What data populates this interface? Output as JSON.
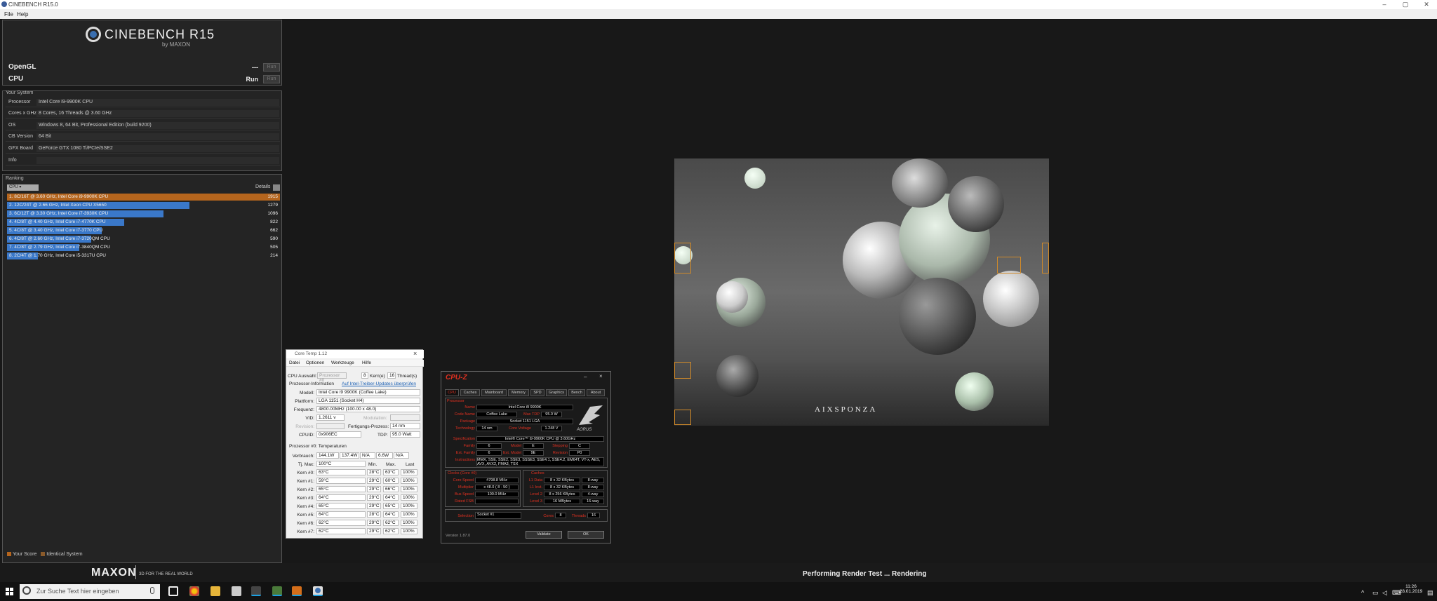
{
  "window": {
    "title": "CINEBENCH R15.0",
    "minimize": "–",
    "maximize": "▢",
    "close": "✕"
  },
  "menu": [
    "File",
    "Help"
  ],
  "logo": {
    "name": "CINEBENCH R15",
    "sub": "by MAXON"
  },
  "tests": [
    {
      "name": "OpenGL",
      "value": "---",
      "button": "Run"
    },
    {
      "name": "CPU",
      "value": "Run",
      "button": "Run"
    }
  ],
  "system": {
    "title": "Your System",
    "rows": [
      {
        "key": "Processor",
        "value": "Intel Core i9-9900K CPU"
      },
      {
        "key": "Cores x GHz",
        "value": "8 Cores, 16 Threads @ 3.60 GHz"
      },
      {
        "key": "OS",
        "value": "Windows 8, 64 Bit, Professional Edition (build 9200)"
      },
      {
        "key": "CB Version",
        "value": "64 Bit"
      },
      {
        "key": "GFX Board",
        "value": "GeForce GTX 1080 Ti/PCIe/SSE2"
      },
      {
        "key": "Info",
        "value": ""
      }
    ]
  },
  "ranking": {
    "title": "Ranking",
    "select": "CPU",
    "details": "Details",
    "entries": [
      {
        "label": "1. 8C/16T @ 3.60 GHz, Intel Core i9-9900K CPU",
        "score": "1915",
        "fraction": 1.0,
        "color": "#b5651d"
      },
      {
        "label": "2. 12C/24T @ 2.66 GHz, Intel Xeon CPU X5650",
        "score": "1279",
        "fraction": 0.668,
        "color": "#3a78c9"
      },
      {
        "label": "3. 6C/12T @ 3.30 GHz, Intel Core i7-3930K CPU",
        "score": "1096",
        "fraction": 0.572,
        "color": "#3a78c9"
      },
      {
        "label": "4. 4C/8T @ 4.40 GHz, Intel Core i7-4770K CPU",
        "score": "822",
        "fraction": 0.429,
        "color": "#3a78c9"
      },
      {
        "label": "5. 4C/8T @ 3.40 GHz, Intel Core i7-3770 CPU",
        "score": "662",
        "fraction": 0.346,
        "color": "#3a78c9"
      },
      {
        "label": "6. 4C/8T @ 2.60 GHz, Intel Core i7-3720QM CPU",
        "score": "590",
        "fraction": 0.308,
        "color": "#3a78c9"
      },
      {
        "label": "7. 4C/8T @ 2.79 GHz, Intel Core i7-3840QM CPU",
        "score": "505",
        "fraction": 0.264,
        "color": "#3a78c9"
      },
      {
        "label": "8. 2C/4T @ 1.70 GHz, Intel Core i5-3317U CPU",
        "score": "214",
        "fraction": 0.112,
        "color": "#3a78c9"
      }
    ],
    "legend": [
      {
        "label": "Your Score",
        "color": "#b5651d"
      },
      {
        "label": "Identical System",
        "color": "#8a5a2a"
      }
    ]
  },
  "footer": {
    "brand": "MAXON",
    "tagline": "3D FOR THE REAL WORLD",
    "status": "Performing Render Test ... Rendering"
  },
  "render": {
    "brand": "AIXSPONZA"
  },
  "coretemp": {
    "title": "Core Temp 1.12",
    "menu": [
      "Datei",
      "Optionen",
      "Werkzeuge",
      "Hilfe"
    ],
    "cpu_select_label": "CPU Auswahl:",
    "cpu_select": "Prozessor #0",
    "cores": "8",
    "cores_label": "Kern(e)",
    "threads": "16",
    "threads_label": "Thread(s)",
    "info_label": "Prozessor-Information",
    "update_link": "Auf Intel-Treiber-Updates überprüfen",
    "model_label": "Modell:",
    "model": "Intel Core i9 9900K (Coffee Lake)",
    "platform_label": "Plattform:",
    "platform": "LGA 1151 (Socket H4)",
    "freq_label": "Frequenz:",
    "freq": "4800.00MHz (100.00 x 48.0)",
    "vid_label": "VID:",
    "vid": "1.2611 v",
    "modulation_label": "Modulation:",
    "revision_label": "Revision:",
    "lithography_label": "Fertigungs-Prozess:",
    "lithography": "14 nm",
    "cpuid_label": "CPUID:",
    "cpuid": "0x906EC",
    "tdp_label": "TDP:",
    "tdp": "95.0 Watt",
    "temps_label": "Prozessor #0: Temperaturen",
    "power_label": "Verbrauch:",
    "power": [
      "144.1W",
      "137.4W",
      "N/A",
      "6.6W",
      "N/A"
    ],
    "tj_label": "Tj. Max:",
    "tj": "100°C",
    "headers": [
      "Min.",
      "Max.",
      "Last"
    ],
    "cores_list": [
      {
        "name": "Kern #0:",
        "cur": "63°C",
        "min": "28°C",
        "max": "63°C",
        "load": "100%"
      },
      {
        "name": "Kern #1:",
        "cur": "59°C",
        "min": "29°C",
        "max": "60°C",
        "load": "100%"
      },
      {
        "name": "Kern #2:",
        "cur": "65°C",
        "min": "29°C",
        "max": "66°C",
        "load": "100%"
      },
      {
        "name": "Kern #3:",
        "cur": "64°C",
        "min": "29°C",
        "max": "64°C",
        "load": "100%"
      },
      {
        "name": "Kern #4:",
        "cur": "65°C",
        "min": "29°C",
        "max": "65°C",
        "load": "100%"
      },
      {
        "name": "Kern #5:",
        "cur": "64°C",
        "min": "28°C",
        "max": "64°C",
        "load": "100%"
      },
      {
        "name": "Kern #6:",
        "cur": "62°C",
        "min": "29°C",
        "max": "62°C",
        "load": "100%"
      },
      {
        "name": "Kern #7:",
        "cur": "62°C",
        "min": "29°C",
        "max": "62°C",
        "load": "100%"
      }
    ]
  },
  "cpuz": {
    "title": "CPU-Z",
    "tabs": [
      "CPU",
      "Caches",
      "Mainboard",
      "Memory",
      "SPD",
      "Graphics",
      "Bench",
      "About"
    ],
    "processor_title": "Processor",
    "name_label": "Name",
    "name": "Intel Core i9 9900K",
    "code_label": "Code Name",
    "code": "Coffee Lake",
    "maxtdp_label": "Max TDP",
    "maxtdp": "95.0 W",
    "package_label": "Package",
    "package": "Socket 1151 LGA",
    "tech_label": "Technology",
    "tech": "14 nm",
    "cv_label": "Core Voltage",
    "cv": "1.248 V",
    "spec_label": "Specification",
    "spec": "Intel® Core™ i9-9900K CPU @ 3.60GHz",
    "family_label": "Family",
    "family": "6",
    "model_label": "Model",
    "model": "E",
    "stepping_label": "Stepping",
    "stepping": "C",
    "extfam_label": "Ext. Family",
    "extfam": "6",
    "extmodel_label": "Ext. Model",
    "extmodel": "9E",
    "revision_label": "Revision",
    "revision": "P0",
    "instr_label": "Instructions",
    "instr": "MMX, SSE, SSE2, SSE3, SSSE3, SSE4.1, SSE4.2, EM64T, VT-x, AES, AVX, AVX2, FMA3, TSX",
    "clocks_title": "Clocks (Core #0)",
    "caches_title": "Caches",
    "corespeed_label": "Core Speed",
    "corespeed": "4798.8 MHz",
    "mult_label": "Multiplier",
    "mult": "x 48.0 ( 8 - 50 )",
    "bus_label": "Bus Speed",
    "bus": "100.0 MHz",
    "fsb_label": "Rated FSB",
    "fsb": "",
    "l1d_label": "L1 Data",
    "l1d": "8 x 32 KBytes",
    "l1d_way": "8-way",
    "l1i_label": "L1 Inst.",
    "l1i": "8 x 32 KBytes",
    "l1i_way": "8-way",
    "l2_label": "Level 2",
    "l2": "8 x 256 KBytes",
    "l2_way": "4-way",
    "l3_label": "Level 3",
    "l3": "16 MBytes",
    "l3_way": "16-way",
    "selection_label": "Selection",
    "selection": "Socket #1",
    "cores_label": "Cores",
    "cores": "8",
    "threads_label": "Threads",
    "threads": "16",
    "version": "Version 1.87.0",
    "validate": "Validate",
    "ok": "OK",
    "brand": "AORUS"
  },
  "taskbar": {
    "search": "Zur Suche Text hier eingeben",
    "time": "11:26",
    "date": "28.01.2019"
  }
}
